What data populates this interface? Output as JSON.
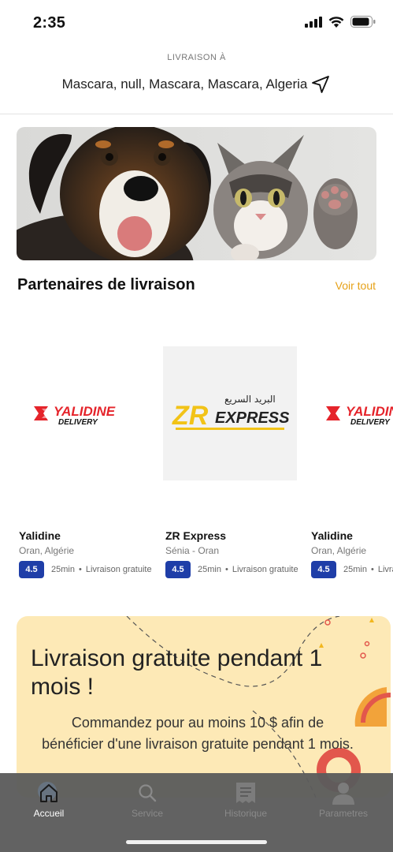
{
  "status_bar": {
    "time": "2:35"
  },
  "header": {
    "label": "LIVRAISON À",
    "address": "Mascara, null, Mascara, Mascara, Algeria"
  },
  "partners_section": {
    "title": "Partenaires de livraison",
    "see_all": "Voir tout",
    "items": [
      {
        "name": "Yalidine",
        "location": "Oran, Algérie",
        "rating": "4.5",
        "time": "25min",
        "fee": "Livraison gratuite",
        "logo_top": "YALIDINE",
        "logo_bottom": "DELIVERY"
      },
      {
        "name": "ZR Express",
        "location": "Sénia - Oran",
        "rating": "4.5",
        "time": "25min",
        "fee": "Livraison gratuite",
        "logo_top": "ZR",
        "logo_bottom": "EXPRESS",
        "logo_arabic": "البريد السريع"
      },
      {
        "name": "Yalidine",
        "location": "Oran, Algérie",
        "rating": "4.5",
        "time": "25min",
        "fee": "Livraison gratuite",
        "logo_top": "YALIDINE",
        "logo_bottom": "DELIVERY"
      }
    ]
  },
  "promo": {
    "title": "Livraison gratuite pendant 1 mois !",
    "body": "Commandez pour au moins 10 $ afin de bénéficier d'une livraison gratuite pendant 1 mois."
  },
  "nav": {
    "items": [
      {
        "label": "Accueil",
        "icon": "home-icon",
        "active": true
      },
      {
        "label": "Service",
        "icon": "search-icon",
        "active": false
      },
      {
        "label": "Historique",
        "icon": "receipt-icon",
        "active": false
      },
      {
        "label": "Parametres",
        "icon": "user-icon",
        "active": false
      }
    ]
  },
  "colors": {
    "accent": "#e6a117",
    "rating": "#1f3ea8",
    "promo_bg": "#fde9b6",
    "nav_bg": "#5c5c5c"
  }
}
